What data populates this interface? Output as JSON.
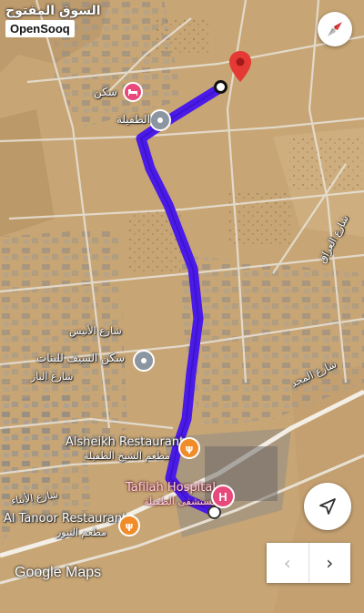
{
  "brand": {
    "arabic": "السوق المفتوح",
    "name": "OpenSooq"
  },
  "map_attribution": "Google Maps",
  "route_color": "#4a1ae6",
  "places": {
    "sakan": "سكن",
    "tafila_label": "الطفيلة",
    "street_anees": "شارع الأنيس",
    "sakan_saif": "سكن السيف للبنات",
    "street_baz": "شارع الباز",
    "alsheikh_en": "Alsheikh Restaurant",
    "alsheikh_ar": "مطعم الشيخ الطفيلة",
    "hospital_en": "Tafilah Hospital",
    "hospital_ar": "مستشفى الطفيلة",
    "street_abnaa": "شارع الأبناء",
    "tanoor_en": "Al Tanoor Restaurant",
    "tanoor_ar": "مطعم التنور",
    "street_iraq": "شارع العراق",
    "street_majd": "شارع المجد"
  },
  "icons": {
    "compass": "compass-icon",
    "navigate": "navigate-arrow-icon",
    "pager_prev": "‹",
    "pager_next": "›"
  }
}
